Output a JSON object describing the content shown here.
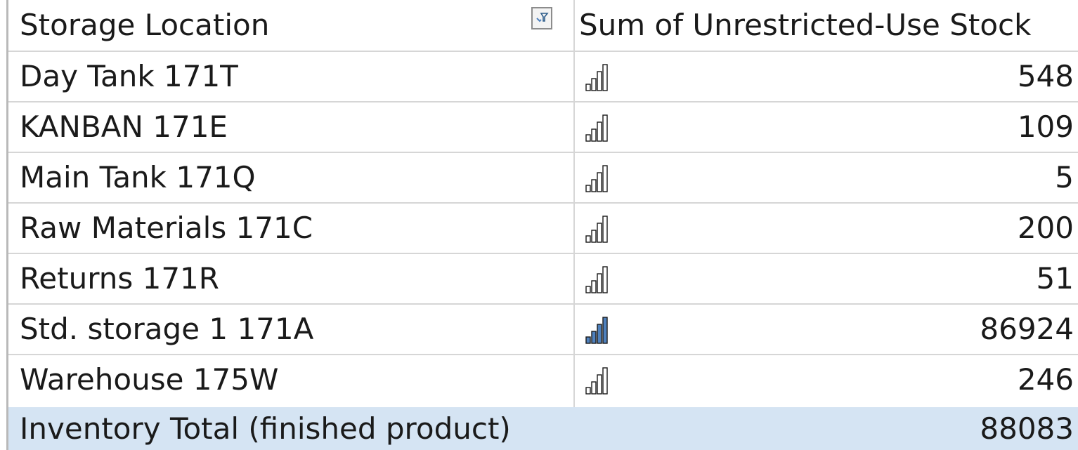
{
  "pivot": {
    "header": {
      "row_label": "Storage Location",
      "value_label": "Sum of Unrestricted-Use Stock",
      "filter_icon": "filter-dropdown-icon"
    },
    "rows": [
      {
        "label": "Day Tank 171T",
        "value": "548",
        "icon": "signal-bars-icon",
        "icon_level": 0
      },
      {
        "label": "KANBAN 171E",
        "value": "109",
        "icon": "signal-bars-icon",
        "icon_level": 0
      },
      {
        "label": "Main Tank 171Q",
        "value": "5",
        "icon": "signal-bars-icon",
        "icon_level": 0
      },
      {
        "label": "Raw Materials 171C",
        "value": "200",
        "icon": "signal-bars-icon",
        "icon_level": 0
      },
      {
        "label": "Returns 171R",
        "value": "51",
        "icon": "signal-bars-icon",
        "icon_level": 0
      },
      {
        "label": "Std. storage 1 171A",
        "value": "86924",
        "icon": "signal-bars-icon",
        "icon_level": 4
      },
      {
        "label": "Warehouse 175W",
        "value": "246",
        "icon": "signal-bars-icon",
        "icon_level": 0
      }
    ],
    "total": {
      "label": "Inventory Total (finished product)",
      "value": "88083"
    },
    "colors": {
      "total_fill": "#d5e4f3",
      "icon_fill": "#4f81bd",
      "icon_outline": "#1a1a1a"
    }
  }
}
